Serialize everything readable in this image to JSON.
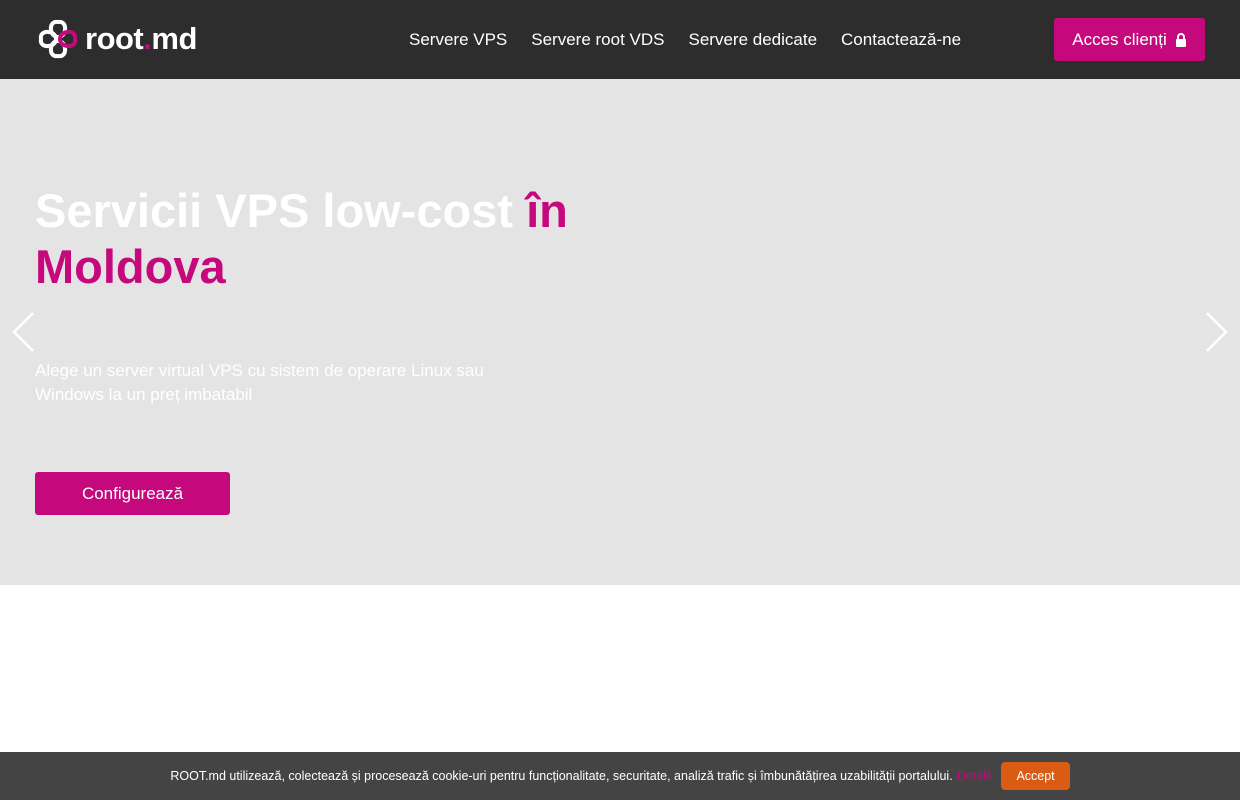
{
  "header": {
    "logo_text_main": "root",
    "logo_text_dot": ".",
    "logo_text_ext": "md",
    "nav": [
      {
        "label": "Servere VPS"
      },
      {
        "label": "Servere root VDS"
      },
      {
        "label": "Servere dedicate"
      },
      {
        "label": "Contactează-ne"
      }
    ],
    "client_button": "Acces clienți"
  },
  "hero": {
    "title_white": "Servicii VPS low-cost",
    "title_accent_in": "în",
    "title_accent": "Moldova",
    "subtitle": "Alege un server virtual VPS cu sistem de operare Linux sau Windows la un preț imbatabil",
    "cta": "Configurează"
  },
  "cookie": {
    "text": "ROOT.md utilizează, colectează și procesează cookie-uri pentru funcționalitate, securitate, analiză trafic și îmbunătățirea uzabilității portalului.",
    "link": "Detalii",
    "accept": "Accept"
  },
  "colors": {
    "brand": "#c5097c",
    "header_bg": "#2d2d2d",
    "hero_bg": "#e4e4e4",
    "cookie_bg": "#444444",
    "accept_bg": "#d95b14"
  },
  "icons": {
    "logo": "clover-logo-icon",
    "lock": "lock-icon",
    "prev": "chevron-left-icon",
    "next": "chevron-right-icon"
  }
}
